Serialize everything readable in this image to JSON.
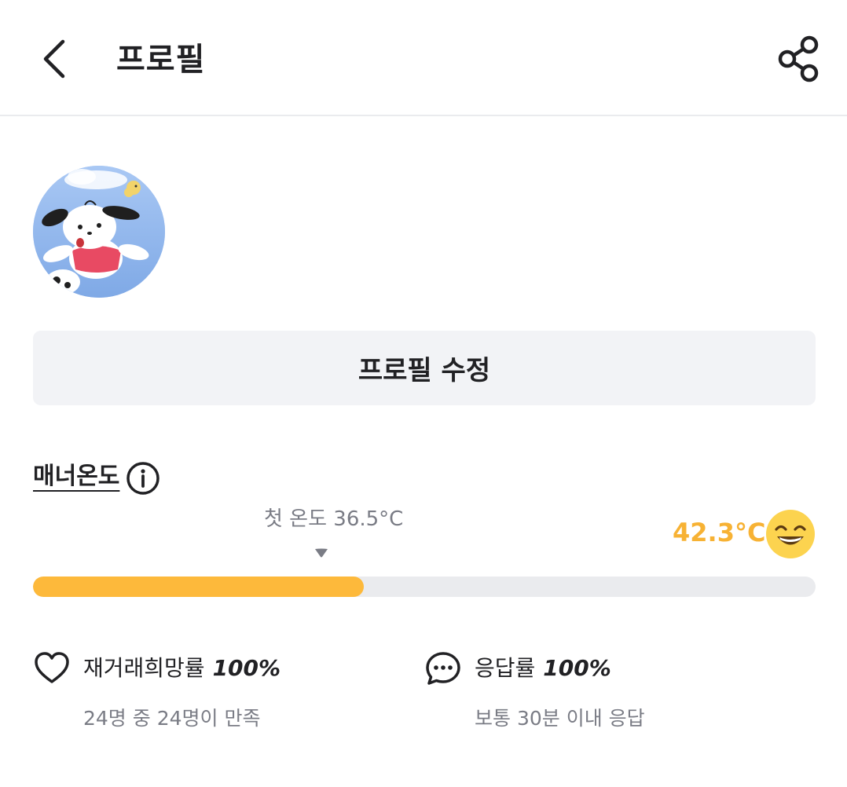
{
  "header": {
    "title": "프로필",
    "back_icon": "chevron-left-icon",
    "share_icon": "share-icon"
  },
  "profile": {
    "avatar_icon": "avatar-image",
    "edit_button_label": "프로필 수정"
  },
  "manner": {
    "label": "매너온도",
    "info_icon": "info-icon",
    "first_temp_label": "첫 온도 36.5°C",
    "current_temp": "42.3°C",
    "progress_fraction": 0.423,
    "accent_color": "#fdb93b"
  },
  "stats": {
    "rebuy": {
      "icon": "heart-icon",
      "label": "재거래희망률",
      "value": "100%",
      "sub": "24명 중 24명이 만족"
    },
    "response": {
      "icon": "chat-bubble-icon",
      "label": "응답률",
      "value": "100%",
      "sub": "보통 30분 이내 응답"
    }
  }
}
